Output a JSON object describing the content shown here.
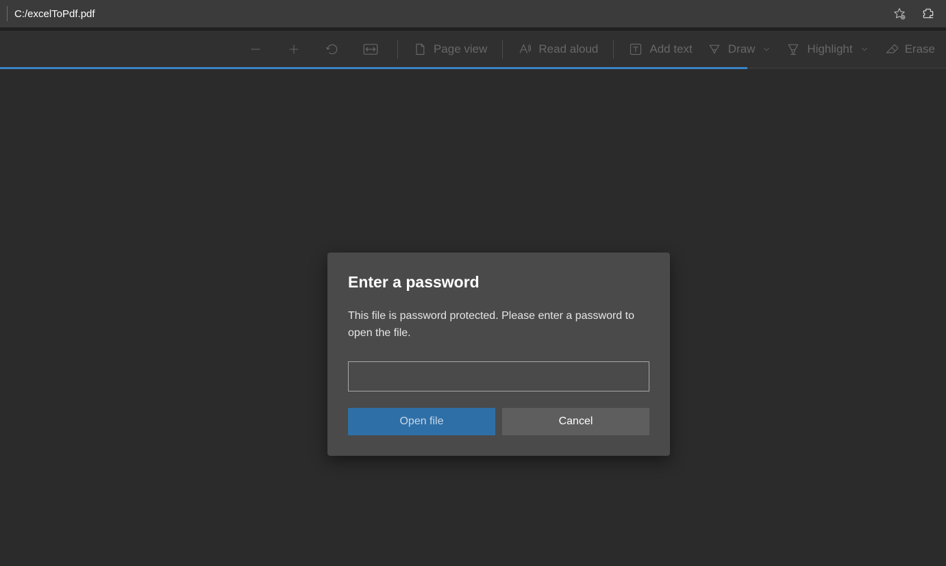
{
  "address_bar": {
    "url": "C:/excelToPdf.pdf"
  },
  "toolbar": {
    "page_view": "Page view",
    "read_aloud": "Read aloud",
    "add_text": "Add text",
    "draw": "Draw",
    "highlight": "Highlight",
    "erase": "Erase"
  },
  "progress_percent": 79,
  "dialog": {
    "title": "Enter a password",
    "body": "This file is password protected. Please enter a password to open the file.",
    "value": "",
    "open": "Open file",
    "cancel": "Cancel"
  }
}
